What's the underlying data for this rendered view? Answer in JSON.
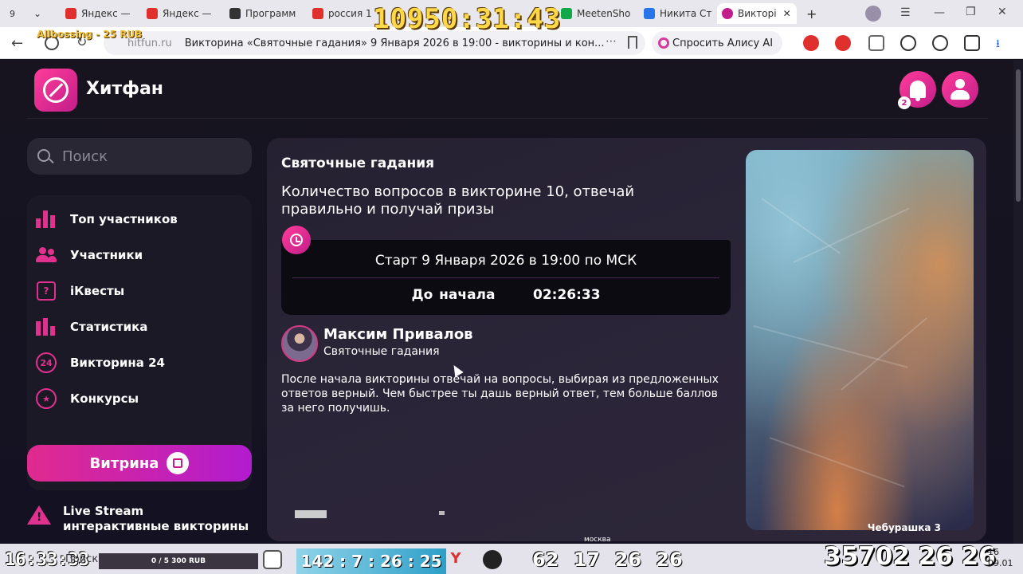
{
  "browser": {
    "tab_count": "9",
    "tabs": [
      {
        "label": "Яндекс — ",
        "color": "#e0302e"
      },
      {
        "label": "Яндекс — ",
        "color": "#e0302e"
      },
      {
        "label": "Программ",
        "color": "#333333"
      },
      {
        "label": "россия 1",
        "color": "#e0302e"
      },
      {
        "label": "MeetenSho",
        "color": "#10a84b"
      },
      {
        "label": "Никита Ст",
        "color": "#2775e8"
      },
      {
        "label": "Викторі",
        "color": "#c21d8a"
      }
    ],
    "address_host": "hitfun.ru",
    "address_title": "Викторина «Святочные гадания» 9 Января 2026 в 19:00 - викторины и кон...",
    "alice_label": "Спросить Алису AI"
  },
  "overlays": {
    "top_counter": "10950:31:43",
    "donation": "Allbossing - 25 RUB"
  },
  "site": {
    "brand": "Хитфан",
    "notifications_count": "2",
    "search_placeholder": "Поиск",
    "nav": [
      {
        "label": "Топ участников",
        "icon": "bar-chart-icon"
      },
      {
        "label": "Участники",
        "icon": "users-icon"
      },
      {
        "label": "iКвесты",
        "icon": "quest-icon"
      },
      {
        "label": "Статистика",
        "icon": "statistics-icon"
      },
      {
        "label": "Викторина 24",
        "icon": "quiz24-icon"
      },
      {
        "label": "Конкурсы",
        "icon": "contest-icon"
      }
    ],
    "vitrina_label": "Витрина",
    "live_stream": {
      "line1": "Live Stream",
      "line2": "интерактивные викторины"
    },
    "quiz": {
      "title": "Святочные гадания",
      "description": "Количество вопросов в викторине 10, отвечай правильно и получай призы",
      "start": "Старт 9 Января 2026 в 19:00 по МСК",
      "until_label": "До начала",
      "countdown": "02:26:33",
      "author_name": "Максим Привалов",
      "author_sub": "Святочные гадания",
      "body": "После начала викторины отвечай на вопросы, выбирая из предложенных ответов верный. Чем быстрее ты дашь верный ответ, тем больше баллов за него получишь.",
      "image_caption": "Чебурашка 3"
    },
    "moscow_label": "москва"
  },
  "taskbar": {
    "time_left": "16:33:33",
    "search_label": "Поиск",
    "progress_label": "0 / 5 300 RUB",
    "counter": "142 : 7 : 26 : 25",
    "numbers": "62 17 26 26",
    "big_numbers": "35702 26 26",
    "clock_time": "16",
    "clock_date": "09.01"
  }
}
